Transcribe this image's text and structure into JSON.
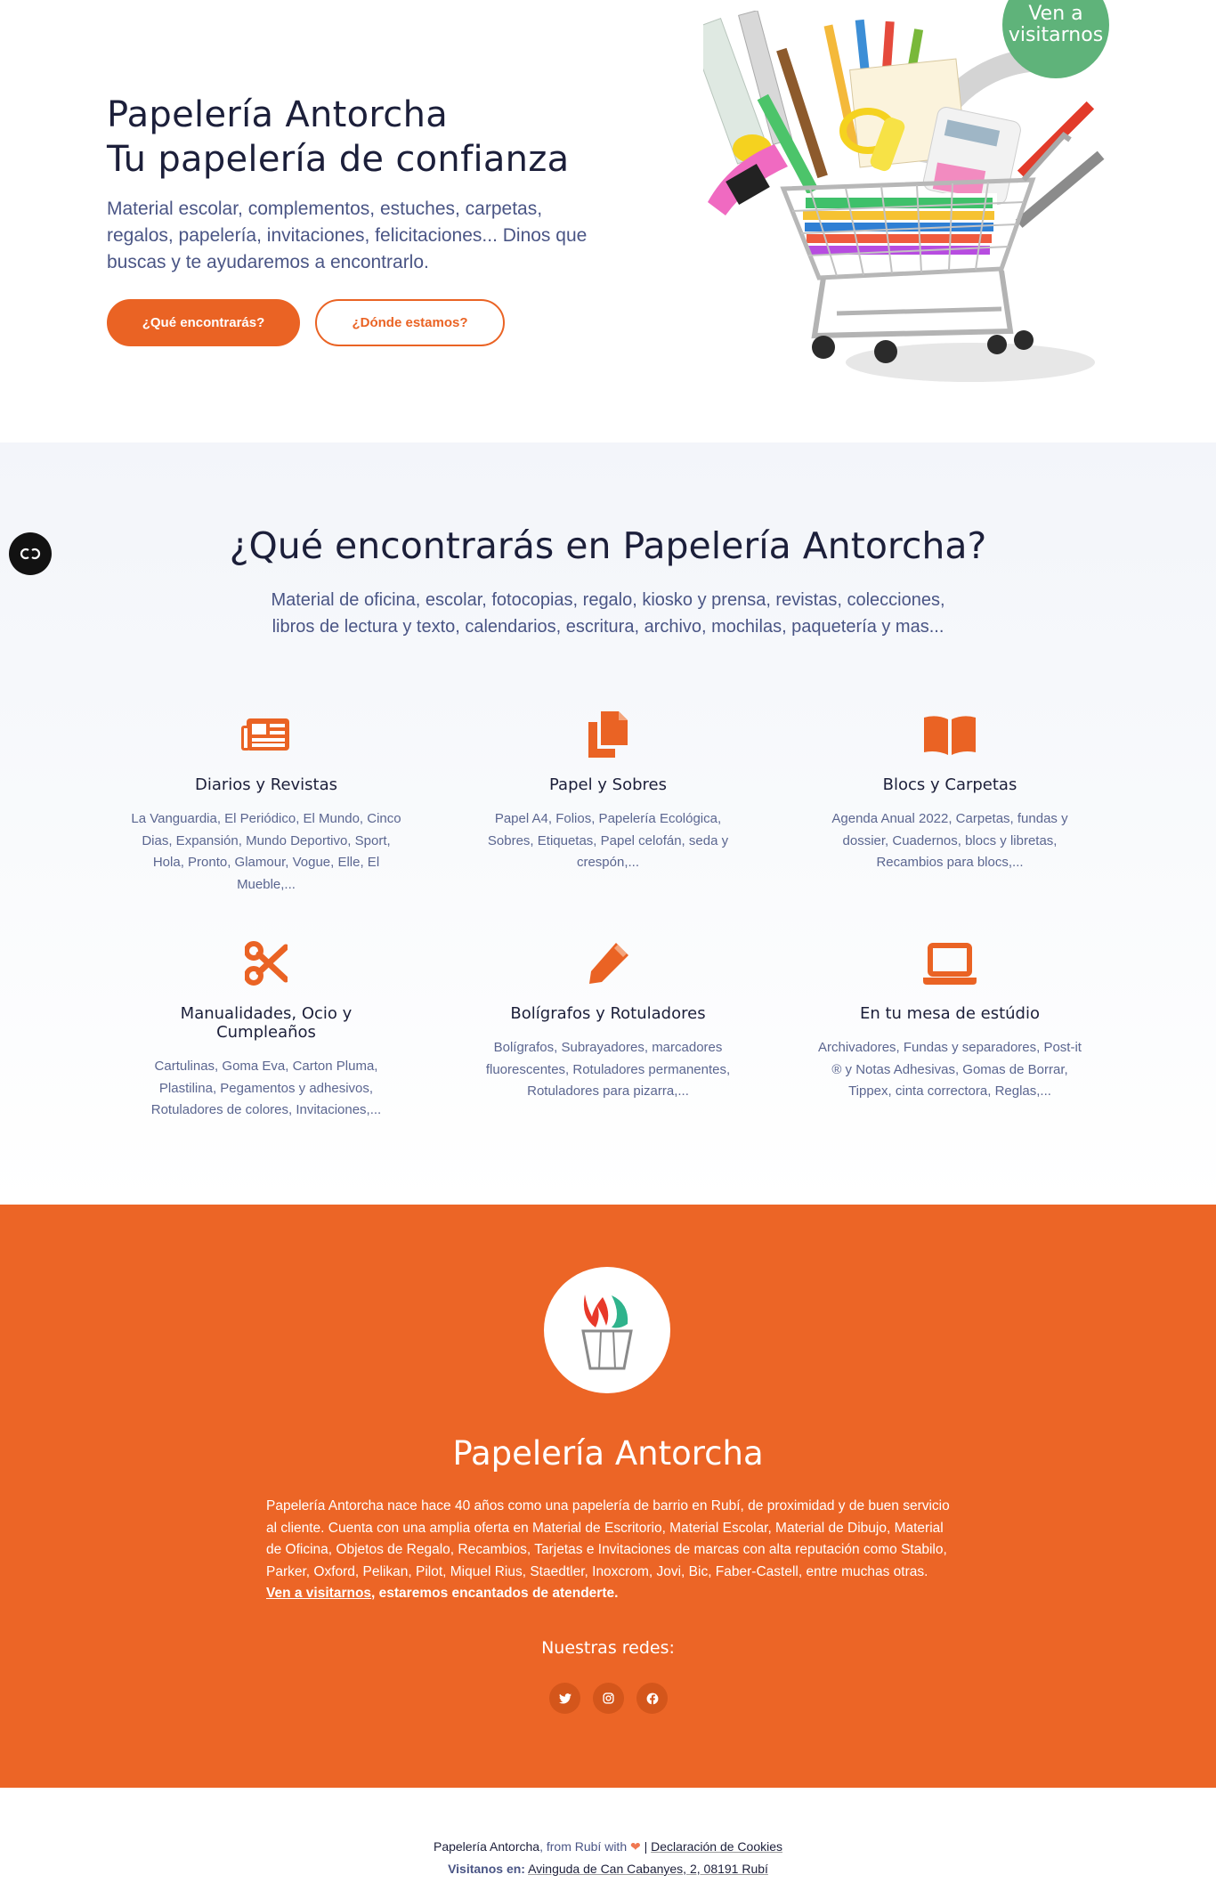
{
  "hero": {
    "title_line1": "Papelería Antorcha",
    "title_line2": "Tu papelería de confianza",
    "description": "Material escolar, complementos, estuches, carpetas, regalos, papelería, invitaciones, felicitaciones... Dinos que buscas y te ayudaremos a encontrarlo.",
    "primary_button": "¿Qué encontrarás?",
    "secondary_button": "¿Dónde estamos?",
    "badge_line1": "Ven a",
    "badge_line2": "visitarnos"
  },
  "features": {
    "title": "¿Qué encontrarás en Papelería Antorcha?",
    "subtitle": "Material de oficina, escolar, fotocopias, regalo, kiosko y prensa, revistas, colecciones, libros de lectura y texto, calendarios, escritura, archivo, mochilas, paquetería y mas...",
    "items": [
      {
        "icon": "newspaper-icon",
        "name": "Diarios y Revistas",
        "desc": "La Vanguardia, El Periódico, El Mundo, Cinco Dias, Expansión, Mundo Deportivo, Sport, Hola, Pronto, Glamour, Vogue, Elle, El Mueble,..."
      },
      {
        "icon": "copy-icon",
        "name": "Papel y Sobres",
        "desc": "Papel A4, Folios, Papelería Ecológica, Sobres, Etiquetas, Papel celofán, seda y crespón,..."
      },
      {
        "icon": "book-open-icon",
        "name": "Blocs y Carpetas",
        "desc": "Agenda Anual 2022, Carpetas, fundas y dossier, Cuadernos, blocs y libretas, Recambios para blocs,..."
      },
      {
        "icon": "scissors-icon",
        "name": "Manualidades, Ocio y Cumpleaños",
        "desc": "Cartulinas, Goma Eva, Carton Pluma, Plastilina, Pegamentos y adhesivos, Rotuladores de colores, Invitaciones,..."
      },
      {
        "icon": "pen-icon",
        "name": "Bolígrafos y Rotuladores",
        "desc": "Bolígrafos, Subrayadores, marcadores fluorescentes, Rotuladores permanentes, Rotuladores para pizarra,..."
      },
      {
        "icon": "laptop-icon",
        "name": "En tu mesa de estúdio",
        "desc": "Archivadores, Fundas y separadores, Post-it ® y Notas Adhesivas, Gomas de Borrar, Tippex, cinta correctora, Reglas,..."
      }
    ]
  },
  "about": {
    "title": "Papelería Antorcha",
    "text": "Papelería Antorcha nace hace 40 años como una papelería de barrio en Rubí, de proximidad y de buen servicio al cliente. Cuenta con una amplia oferta en Material de Escritorio, Material Escolar, Material de Dibujo, Material de Oficina, Objetos de Regalo, Recambios, Tarjetas e Invitaciones de marcas con alta reputación como Stabilo, Parker, Oxford, Pelikan, Pilot, Miquel Rius, Staedtler, Inoxcrom, Jovi, Bic, Faber-Castell, entre muchas otras.",
    "link_text": "Ven a visitarnos",
    "closing": ", estaremos encantados de atenderte.",
    "social_title": "Nuestras redes:",
    "social": [
      "twitter-icon",
      "instagram-icon",
      "facebook-icon"
    ]
  },
  "footer": {
    "brand": "Papelería Antorcha",
    "from_text": ", from Rubí with",
    "separator": "|",
    "cookies": "Declaración de Cookies",
    "visit_label": "Visitanos en:",
    "address": "Avinguda de Can Cabanyes, 2, 08191 Rubí"
  },
  "colors": {
    "accent": "#ea6324",
    "about_bg": "#ec6526",
    "badge": "#5fb37a",
    "heading": "#1c1f3a",
    "text": "#4a5585"
  }
}
